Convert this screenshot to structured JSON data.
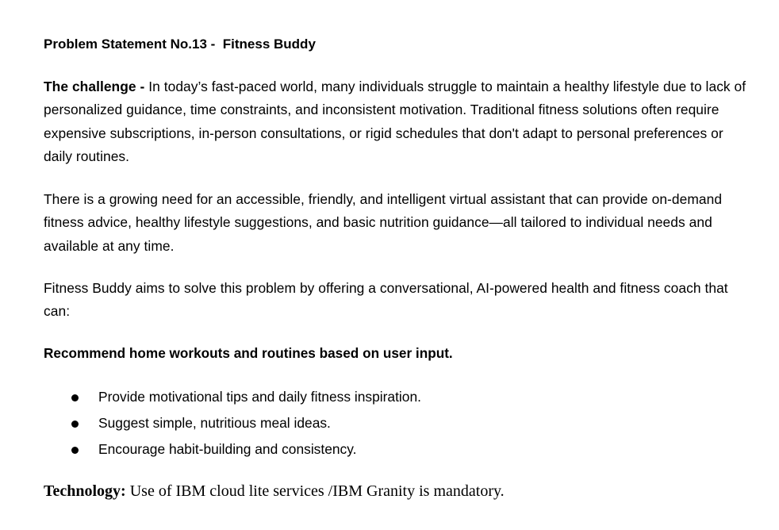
{
  "document": {
    "title": "Problem Statement No.13 -  Fitness Buddy",
    "challenge_label": "The challenge - ",
    "challenge_text": "In today’s fast-paced world, many individuals struggle to maintain a healthy lifestyle due to lack of personalized guidance, time constraints, and inconsistent motivation. Traditional fitness solutions often require expensive subscriptions, in-person consultations, or rigid schedules that don't adapt to personal preferences or daily routines.",
    "need_text": "There is a growing need for an accessible, friendly, and intelligent virtual assistant that can provide on-demand fitness advice, healthy lifestyle suggestions, and basic nutrition guidance—all tailored to individual needs and available at any time.",
    "aim_text": "Fitness Buddy aims to solve this problem by offering a conversational, AI-powered health and fitness coach that can:",
    "subheading": "Recommend home workouts and routines based on user input.",
    "bullets": [
      "Provide motivational tips and daily fitness inspiration.",
      "Suggest simple, nutritious meal ideas.",
      "Encourage habit-building and consistency."
    ],
    "technology_label": "Technology:",
    "technology_text": " Use of IBM cloud lite services /IBM Granity is mandatory."
  }
}
